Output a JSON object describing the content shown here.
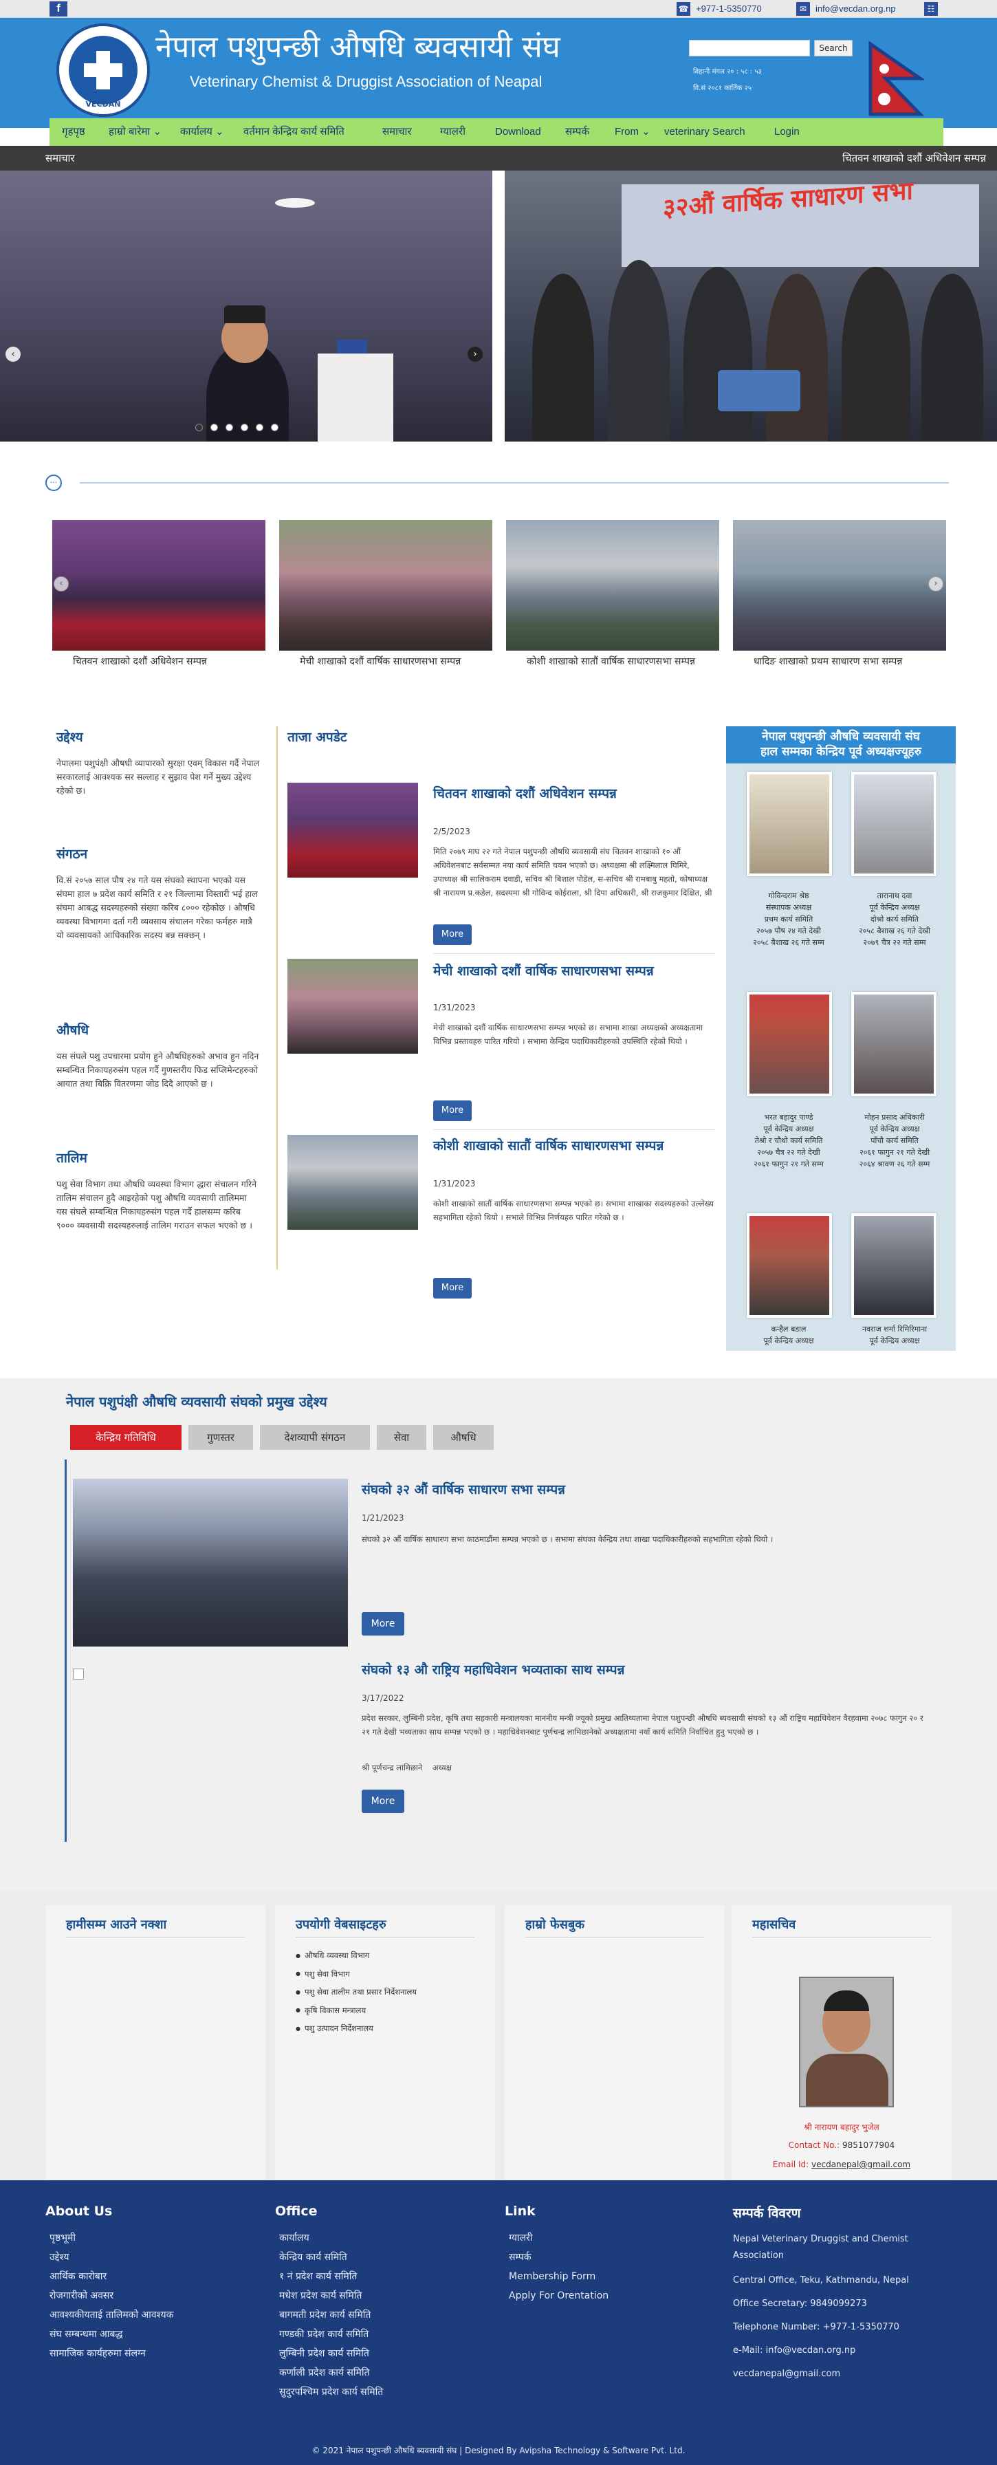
{
  "topbar": {
    "facebook_label": "f",
    "phone": "+977-1-5350770",
    "email": "info@vecdan.org.np",
    "phone_icon": "phone-icon",
    "email_icon": "email-icon",
    "extra_icon": "share-icon"
  },
  "header": {
    "title_np": "नेपाल पशुपन्छी औषधि ब्यवसायी संघ",
    "title_en": "Veterinary Chemist & Druggist Association of Neapal",
    "logo_text": "VECDAN",
    "search_placeholder": "",
    "search_button": "Search",
    "date_np": "बिहानी मंगल २० : ५८ : ५३",
    "date_np2": "वि.सं २०८१ कार्तिक २५"
  },
  "nav": {
    "items": [
      {
        "label": "गृहपृष्ठ",
        "dropdown": false
      },
      {
        "label": "हाम्रो बारेमा",
        "dropdown": true
      },
      {
        "label": "कार्यालय",
        "dropdown": true
      },
      {
        "label": "वर्तमान केन्द्रिय कार्य समिति",
        "dropdown": false
      },
      {
        "label": "समाचार",
        "dropdown": false
      },
      {
        "label": "ग्यालरी",
        "dropdown": false
      },
      {
        "label": "Download",
        "dropdown": false
      },
      {
        "label": "सम्पर्क",
        "dropdown": false
      },
      {
        "label": "From",
        "dropdown": true
      },
      {
        "label": "veterinary Search",
        "dropdown": false
      },
      {
        "label": "Login",
        "dropdown": false
      }
    ]
  },
  "ticker": {
    "label": "समाचार",
    "text": "चितवन शाखाको दशौं अधिवेशन सम्पन्न"
  },
  "slider": {
    "banner_text": "३२औं वार्षिक साधारण सभा",
    "dots": 6,
    "active_dot": 0
  },
  "gallery": {
    "captions": [
      "चितवन शाखाको दशौं अधिवेशन सम्पन्न",
      "मेची शाखाको दशौं वार्षिक साधारणसभा सम्पन्न",
      "कोशी शाखाको सातौं वार्षिक साधारणसभा सम्पन्न",
      "धादिङ शाखाको प्रथम साधारण सभा सम्पन्न"
    ]
  },
  "about": {
    "sections": [
      {
        "heading": "उद्देश्य",
        "text": "नेपालमा पशुपंक्षी औषधी व्यापारको सुरक्षा एवम् विकास गर्दै नेपाल सरकारलाई आवश्यक सर सल्लाह र सुझाव पेश गर्ने मुख्य उद्देश्य रहेको छ।"
      },
      {
        "heading": "संगठन",
        "text": "वि.सं २०५७ साल पौष २४ गते यस संघको स्थापना भएको यस संघमा हाल ७ प्रदेश कार्य समिति र २१ जिल्लामा विस्तारी भई हाल संघमा आबद्ध सदस्यहरुको संख्या करिब ८००० रहेकोछ । औषधि व्यवस्था विभागमा दर्ता गरी व्यवसाय संचालन गरेका फर्महरु मात्रै यो व्यवसायको आधिकारिक सदस्य बन्न सक्छन् ।"
      },
      {
        "heading": "औषधि",
        "text": "यस संघले पशु उपचारमा प्रयोग हुने औषधिहरुको अभाव हुन नदिन सम्बन्धित निकायहरुसंग पहल गर्दै गुणस्तरीय फिड सप्लिमेन्टहरुको आयात तथा बिक्रि वितरणमा जोड दिदै आएको छ ।"
      },
      {
        "heading": "तालिम",
        "text": "पशु सेवा विभाग तथा औषधि व्यवस्था विभाग द्धारा संचालन गरिने तालिम संचालन हुदै आइरहेको पशु औषधि व्यवसायी तालिममा यस संघले सम्बन्धित निकायहरुसंग पहल गर्दै हालसम्म करिब ९००० व्यवसायी सदस्यहरुलाई तालिम गराउन सफल भएको छ ।"
      }
    ]
  },
  "latest": {
    "heading": "ताजा अपडेट",
    "more_label": "More",
    "items": [
      {
        "title": "चितवन शाखाको दशौं अधिवेशन सम्पन्न",
        "date": "2/5/2023",
        "body": "मिति २०७९ माघ २२ गते नेपाल पशुपन्छी औषधि ब्यवसायी संघ चितवन शाखाको १० औं अधिवेशनबाट सर्वसम्मत नया कार्य समिति चयन भएको छ। अध्यक्षमा श्री लक्ष्मिलाल घिमिरे, उपाध्यक्ष श्री सालिकराम दवाडी, सचिव श्री बिशाल पौडेल, स-सचिव श्री रामबाबु महतो, कोषाध्यक्ष श्री नारायण प्र.कडेल, सदस्यमा श्री गोविन्द कोईराला, श्री दिपा अधिकारी, श्री राजकुमार दिक्षित, श्री विकास"
      },
      {
        "title": "मेची शाखाको दशौं वार्षिक साधारणसभा सम्पन्न",
        "date": "1/31/2023",
        "body": "मेची शाखाको दशौं वार्षिक साधारणसभा सम्पन्न भएको छ। सभामा शाखा अध्यक्षको अध्यक्षतामा विभिन्न प्रस्तावहरु पारित गरियो । सभामा केन्द्रिय पदाधिकारीहरुको उपस्थिति रहेको थियो ।"
      },
      {
        "title": "कोशी शाखाको सातौं वार्षिक साधारणसभा सम्पन्न",
        "date": "1/31/2023",
        "body": "कोशी शाखाको सातौं वार्षिक साधारणसभा सम्पन्न भएको छ। सभामा शाखाका सदस्यहरुको उल्लेख्य सहभागिता रहेको थियो । सभाले विभिन्न निर्णयहरु पारित गरेको छ ।"
      }
    ]
  },
  "leaders": {
    "title_line1": "नेपाल पशुपन्छी औषधि व्यवसायी संघ",
    "title_line2": "हाल सम्मका केन्द्रिय पूर्व अध्यक्षज्यूहरु",
    "people": [
      {
        "name": "गोविन्दराम श्रेष्ठ",
        "role": "संस्थापक अध्यक्ष",
        "line3": "प्रथम कार्य समिति",
        "line4": "२०५७ पौष २४ गते देखी",
        "line5": "२०५८ बैशाख २६ गते सम्म"
      },
      {
        "name": "तारानाथ दवा",
        "role": "पूर्व केन्द्रिय अध्यक्ष",
        "line3": "दोश्रो कार्य समिति",
        "line4": "२०५८ बैशाख २६ गते देखी",
        "line5": "२०७९ चैत्र २२ गते सम्म"
      },
      {
        "name": "भरत बहादुर पाण्डे",
        "role": "पूर्व केन्द्रिय अध्यक्ष",
        "line3": "तेश्रो र चौथो कार्य समिति",
        "line4": "२०५७ चैत्र २२ गते देखी",
        "line5": "२०६१ फागुन २१ गते सम्म"
      },
      {
        "name": "मोहन प्रसाद अधिकारी",
        "role": "पूर्व केन्द्रिय अध्यक्ष",
        "line3": "पाँचौ कार्य समिति",
        "line4": "२०६१ फागुन २१ गते देखी",
        "line5": "२०६४ श्रावण २६ गते सम्म"
      },
      {
        "name": "कन्हैल बडाल",
        "role": "पूर्व केन्द्रिय अध्यक्ष",
        "line3": "",
        "line4": "",
        "line5": ""
      },
      {
        "name": "नवराज शर्मा रिमिरिमाना",
        "role": "पूर्व केन्द्रिय अध्यक्ष",
        "line3": "",
        "line4": "",
        "line5": ""
      }
    ]
  },
  "objectives": {
    "title": "नेपाल पशुपंक्षी औषधि व्यवसायी संघको प्रमुख उद्देश्य",
    "tabs": [
      "केन्द्रिय गतिविधि",
      "गुणस्तर",
      "देशव्यापी संगठन",
      "सेवा",
      "औषधि"
    ],
    "active_tab": 0,
    "more_label": "More",
    "broken_image_alt": "",
    "items": [
      {
        "title": "संघको ३२ औं वार्षिक साधारण सभा सम्पन्न",
        "date": "1/21/2023",
        "body": "संघको ३२ औं वार्षिक साधारण सभा काठमाडौंमा सम्पन्न भएको छ । सभामा संघका केन्द्रिय तथा शाखा पदाधिकारीहरुको सहभागिता रहेको थियो ।",
        "extra": ""
      },
      {
        "title": "संघको १३ औ राष्ट्रिय महाधिवेशन भव्यताका साथ सम्पन्न",
        "date": "3/17/2022",
        "body": "प्रदेश सरकार, लुम्बिनी प्रदेश, कृषि तथा सहकारी मन्त्रालयका माननीय मन्त्री ज्यूको प्रमुख आतिथ्यतामा नेपाल पशुपन्छी औषधि ब्यवसायी संघको १३ औं राष्ट्रिय महाधिवेशन वैरहवामा २०७८ फागुन २० र २१ गते देखी भव्यताका साथ सम्पन्न भएको छ । महाधिवेशनबाट पूर्णचन्द्र लामिछानेको अध्यक्षतामा नयाँ कार्य समिति निर्वाचित हुनु भएको छ ।",
        "extra": "श्री पूर्णचन्द्र लामिछाने    अध्यक्ष"
      }
    ]
  },
  "widgets": {
    "map_title": "हामीसम्म आउने नक्शा",
    "sites_title": "उपयोगी वेबसाइटहरु",
    "sites": [
      "औषधि व्यवस्था विभाग",
      "पशु सेवा विभाग",
      "पशु सेवा तालीम तथा प्रसार निर्देशनालय",
      "कृषि विकास मन्त्रालय",
      "पशु उत्पादन निर्देशनालय"
    ],
    "facebook_title": "हाम्रो फेसबुक",
    "secretary_title": "महासचिव",
    "secretary_name": "श्री नारायण बहादुर भुजेल",
    "secretary_contact_label": "Contact No.:",
    "secretary_contact": "9851077904",
    "secretary_email_label": "Email Id:",
    "secretary_email": "vecdanepal@gmail.com"
  },
  "footer": {
    "about_title": "About Us",
    "about_items": [
      "पृष्ठभूमी",
      "उद्देश्य",
      "आर्थिक कारोबार",
      "रोजगारीको अवसर",
      "आवश्यकीयताई तालिमको आवश्यक",
      "संघ सम्बन्धमा आबद्ध",
      "सामाजिक कार्यहरुमा संलग्न"
    ],
    "office_title": "Office",
    "office_items": [
      "कार्यालय",
      "केन्द्रिय कार्य समिति",
      "१ नं प्रदेश कार्य समिति",
      "मधेश प्रदेश कार्य समिति",
      "बागमती प्रदेश कार्य समिति",
      "गण्डकी प्रदेश कार्य समिति",
      "लुम्बिनी प्रदेश कार्य समिति",
      "कर्णाली प्रदेश कार्य समिति",
      "सुदुरपश्चिम प्रदेश कार्य समिति"
    ],
    "link_title": "Link",
    "link_items": [
      "ग्यालरी",
      "सम्पर्क",
      "Membership Form",
      "Apply For Orentation"
    ],
    "contact_title": "सम्पर्क विवरण",
    "contact_lines": [
      "Nepal Veterinary Druggist and Chemist Association",
      "Central Office, Teku, Kathmandu, Nepal",
      "Office Secretary: 9849099273",
      "Telephone Number: +977-1-5350770",
      "e-Mail: info@vecdan.org.np",
      "vecdanepal@gmail.com"
    ],
    "copyright": "© 2021 नेपाल पशुपन्छी औषधि ब्यवसायी संघ | Designed By Avipsha Technology & Software Pvt. Ltd."
  },
  "colors": {
    "header_blue": "#2f8ad2",
    "nav_green": "#a1e06c",
    "ticker_dark": "#3c3c3c",
    "heading_blue": "#16508f",
    "active_red": "#d71f26",
    "footer_navy": "#1d3c7c"
  }
}
